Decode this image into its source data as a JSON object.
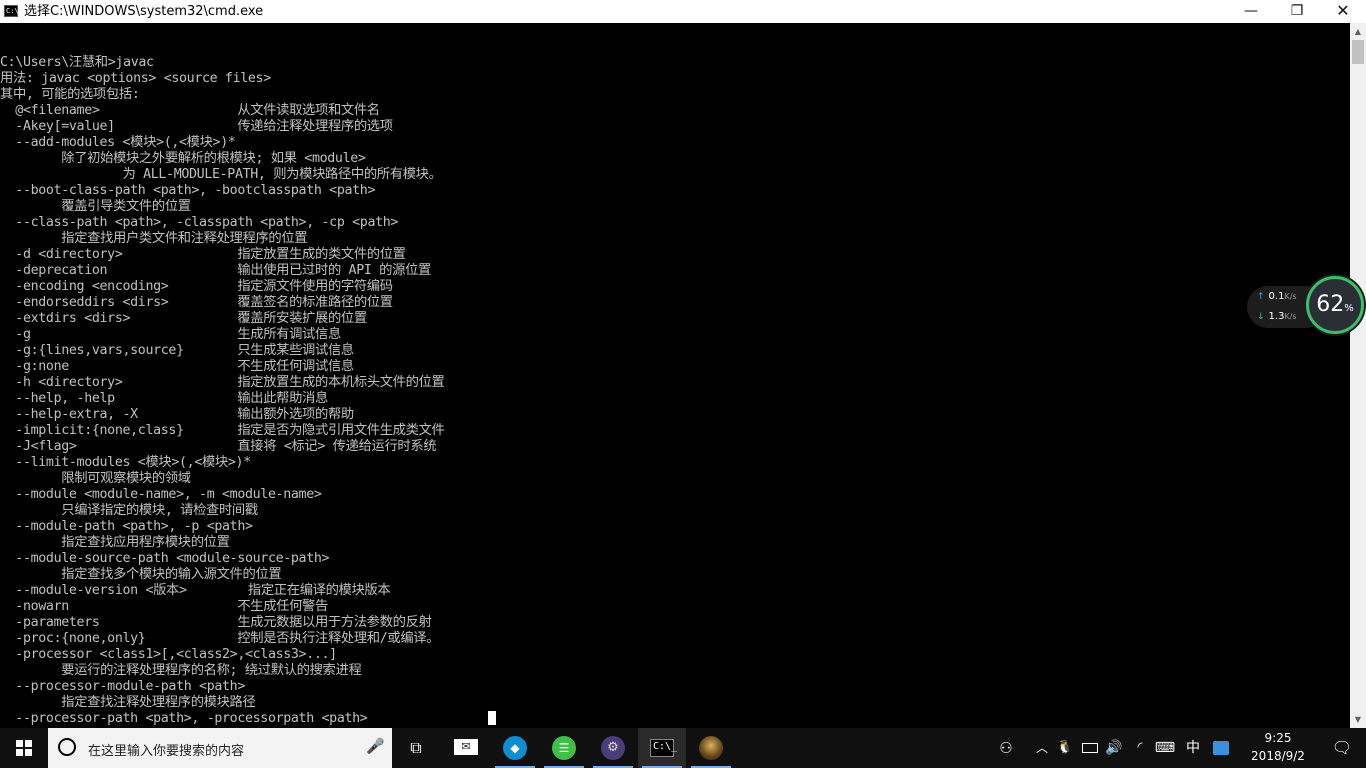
{
  "window": {
    "title": "选择C:\\WINDOWS\\system32\\cmd.exe",
    "icon": "C:\\",
    "minimize": "—",
    "maximize": "❐",
    "close": "✕"
  },
  "console": {
    "lines": [
      "C:\\Users\\汪慧和>javac",
      "用法: javac <options> <source files>",
      "其中, 可能的选项包括:",
      "  @<filename>                  从文件读取选项和文件名",
      "  -Akey[=value]                传递给注释处理程序的选项",
      "  --add-modules <模块>(,<模块>)*",
      "        除了初始模块之外要解析的根模块; 如果 <module>",
      "                为 ALL-MODULE-PATH, 则为模块路径中的所有模块。",
      "  --boot-class-path <path>, -bootclasspath <path>",
      "        覆盖引导类文件的位置",
      "  --class-path <path>, -classpath <path>, -cp <path>",
      "        指定查找用户类文件和注释处理程序的位置",
      "  -d <directory>               指定放置生成的类文件的位置",
      "  -deprecation                 输出使用已过时的 API 的源位置",
      "  -encoding <encoding>         指定源文件使用的字符编码",
      "  -endorseddirs <dirs>         覆盖签名的标准路径的位置",
      "  -extdirs <dirs>              覆盖所安装扩展的位置",
      "  -g                           生成所有调试信息",
      "  -g:{lines,vars,source}       只生成某些调试信息",
      "  -g:none                      不生成任何调试信息",
      "  -h <directory>               指定放置生成的本机标头文件的位置",
      "  --help, -help                输出此帮助消息",
      "  --help-extra, -X             输出额外选项的帮助",
      "  -implicit:{none,class}       指定是否为隐式引用文件生成类文件",
      "  -J<flag>                     直接将 <标记> 传递给运行时系统",
      "  --limit-modules <模块>(,<模块>)*",
      "        限制可观察模块的领域",
      "  --module <module-name>, -m <module-name>",
      "        只编译指定的模块, 请检查时间戳",
      "  --module-path <path>, -p <path>",
      "        指定查找应用程序模块的位置",
      "  --module-source-path <module-source-path>",
      "        指定查找多个模块的输入源文件的位置",
      "  --module-version <版本>        指定正在编译的模块版本",
      "  -nowarn                      不生成任何警告",
      "  -parameters                  生成元数据以用于方法参数的反射",
      "  -proc:{none,only}            控制是否执行注释处理和/或编译。",
      "  -processor <class1>[,<class2>,<class3>...]",
      "        要运行的注释处理程序的名称; 绕过默认的搜索进程",
      "  --processor-module-path <path>",
      "        指定查找注释处理程序的模块路径",
      "  --processor-path <path>, -processorpath <path>"
    ]
  },
  "scrollbar": {
    "up_arrow": "▲",
    "down_arrow": "▼"
  },
  "net_widget": {
    "upload": "0.1",
    "download": "1.3",
    "unit": "K/s",
    "up_arrow": "↑",
    "down_arrow": "↓",
    "percent": "62",
    "percent_sign": "%"
  },
  "taskbar": {
    "search_placeholder": "在这里输入你要搜索的内容",
    "mic_glyph": "🎤",
    "apps": [
      {
        "name": "task-view",
        "glyph": "⧉"
      },
      {
        "name": "mail",
        "glyph": "✉"
      },
      {
        "name": "blue-app",
        "glyph": "◆"
      },
      {
        "name": "green-app",
        "glyph": "☰"
      },
      {
        "name": "gear-app",
        "glyph": "⚙"
      },
      {
        "name": "cmd",
        "glyph": "C:\\_"
      },
      {
        "name": "photo",
        "glyph": ""
      }
    ],
    "tray": {
      "people": "⚇",
      "chevron": "︿",
      "qq": "🐧",
      "volume": "🔊",
      "network": "◜",
      "keyboard": "⌨",
      "ime": "中",
      "notify": "🗨"
    },
    "clock": {
      "time": "9:25",
      "date": "2018/9/2"
    }
  }
}
